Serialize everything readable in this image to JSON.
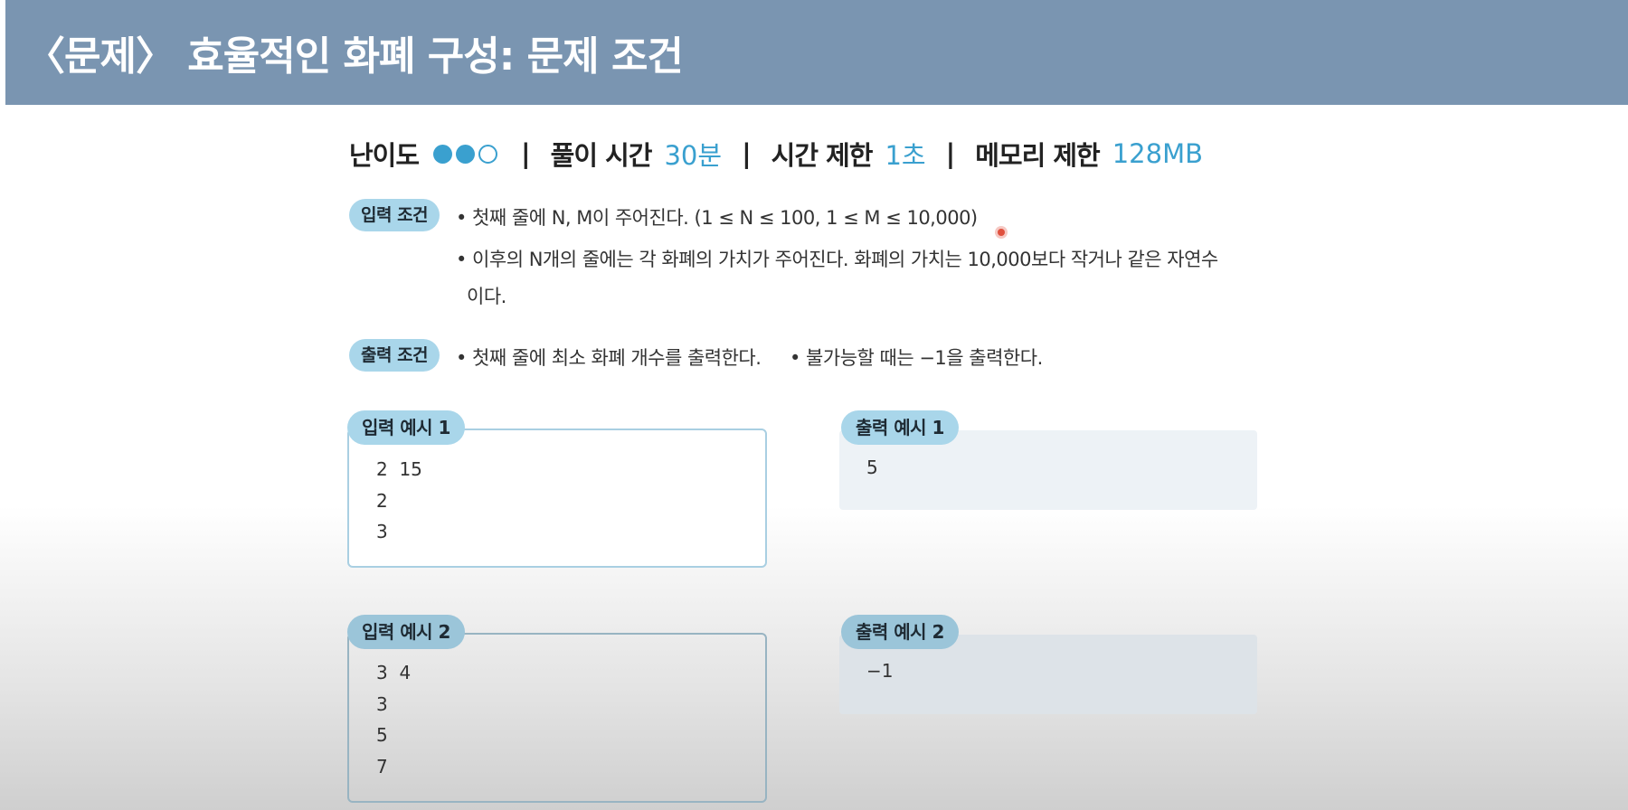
{
  "header": {
    "title": "〈문제〉 효율적인 화폐 구성: 문제 조건"
  },
  "meta": {
    "difficulty_label": "난이도",
    "difficulty_level": 2,
    "difficulty_max": 3,
    "separator": "|",
    "solve_time_label": "풀이 시간",
    "solve_time_value": "30분",
    "time_limit_label": "시간 제한",
    "time_limit_value": "1초",
    "memory_limit_label": "메모리 제한",
    "memory_limit_value": "128MB"
  },
  "input_conditions": {
    "label": "입력 조건",
    "bullets": [
      "• 첫째 줄에 N, M이 주어진다. (1 ≤ N ≤ 100, 1 ≤ M ≤ 10,000)",
      "• 이후의 N개의 줄에는 각 화폐의 가치가 주어진다. 화폐의 가치는 10,000보다 작거나 같은 자연수",
      "이다."
    ]
  },
  "output_conditions": {
    "label": "출력 조건",
    "bullets": [
      "• 첫째 줄에  최소 화폐 개수를 출력한다.",
      "• 불가능할 때는 −1을 출력한다."
    ]
  },
  "examples": [
    {
      "input_label": "입력 예시 1",
      "input_lines": [
        "2  15",
        "2",
        "3"
      ],
      "output_label": "출력 예시 1",
      "output_lines": [
        "5"
      ]
    },
    {
      "input_label": "입력 예시 2",
      "input_lines": [
        "3  4",
        "3",
        "5",
        "7"
      ],
      "output_label": "출력 예시 2",
      "output_lines": [
        "−1"
      ]
    }
  ],
  "colors": {
    "header_bg": "#7a95b1",
    "accent": "#3aa0cf",
    "pill_bg": "#a9d6ea",
    "cursor": "#e0503e"
  }
}
